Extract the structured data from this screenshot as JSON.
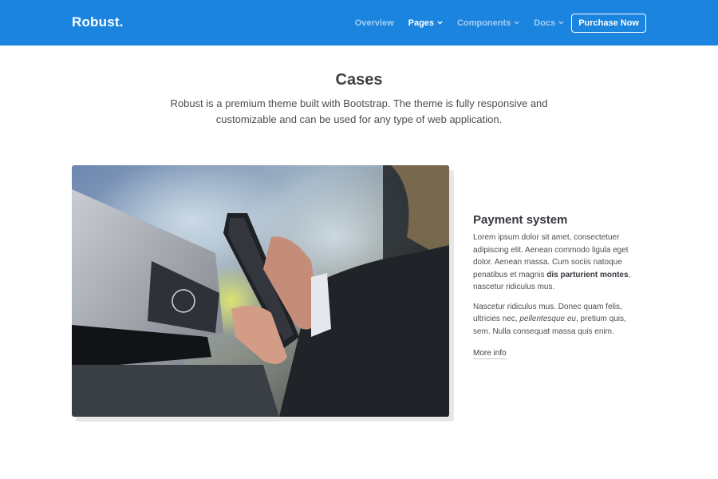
{
  "navbar": {
    "brand": "Robust.",
    "items": [
      {
        "label": "Overview",
        "active": false,
        "dropdown": false
      },
      {
        "label": "Pages",
        "active": true,
        "dropdown": true
      },
      {
        "label": "Components",
        "active": false,
        "dropdown": true
      },
      {
        "label": "Docs",
        "active": false,
        "dropdown": true
      }
    ],
    "cta_label": "Purchase Now",
    "background_color": "#1a84de"
  },
  "hero": {
    "title": "Cases",
    "subtitle": "Robust is a premium theme built with Bootstrap. The theme is fully responsive and customizable and can be used for any type of web application."
  },
  "case": {
    "image_alt": "payment-terminal-photo",
    "title": "Payment system",
    "paragraph1": {
      "before": "Lorem ipsum dolor sit amet, consectetuer adipiscing elit. Aenean commodo ligula eget dolor. Aenean massa. Cum sociis natoque penatibus et magnis ",
      "bold": "dis parturient montes",
      "after": ", nascetur ridiculus mus."
    },
    "paragraph2": {
      "before": "Nascetur ridiculus mus. Donec quam felis, ultricies nec, ",
      "italic": "pellentesque eu",
      "after": ", pretium quis, sem. Nulla consequat massa quis enim."
    },
    "link_label": "More info"
  }
}
